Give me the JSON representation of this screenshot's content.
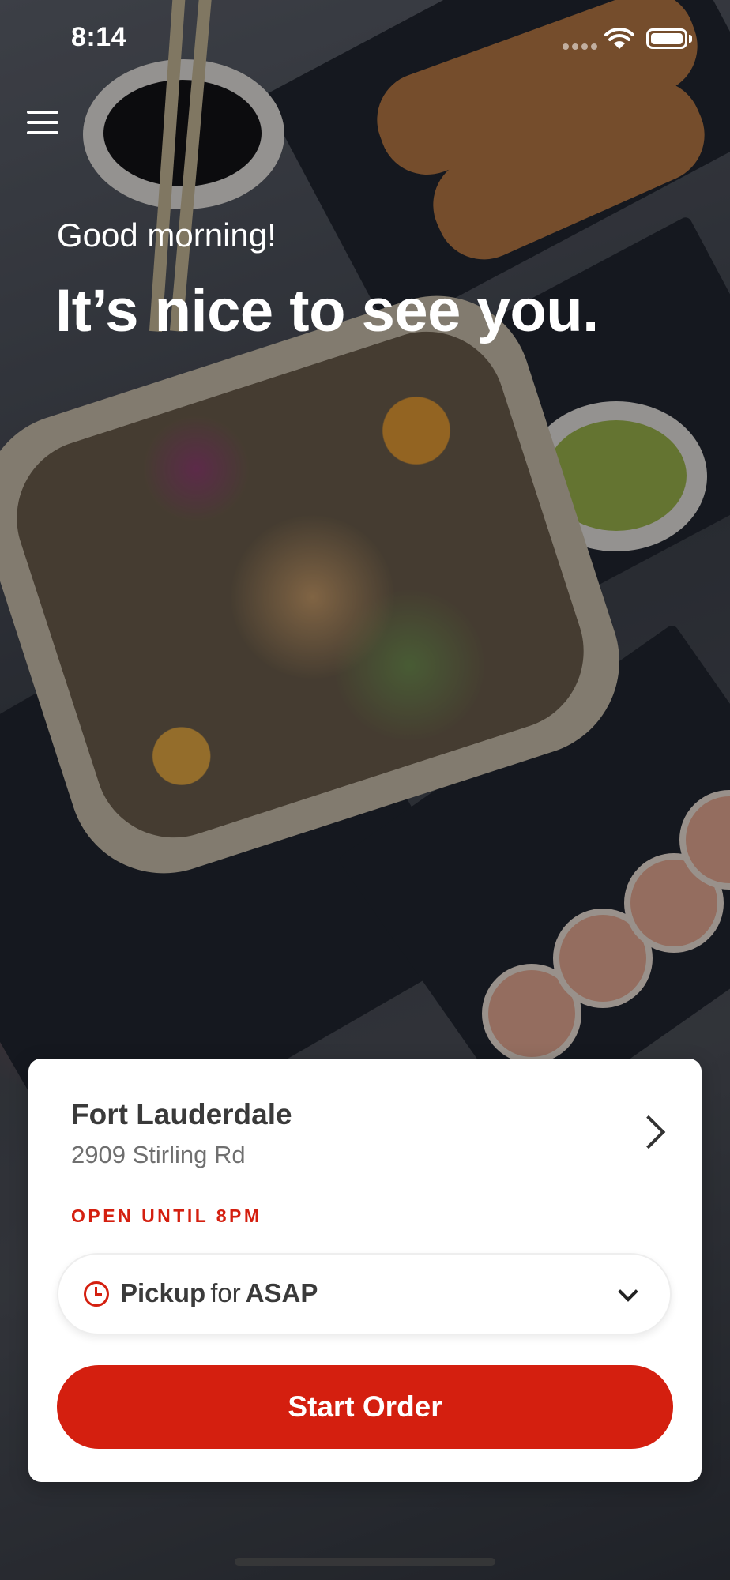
{
  "status_bar": {
    "time": "8:14",
    "icons": [
      "signal-icon",
      "wifi-icon",
      "battery-icon"
    ]
  },
  "header": {
    "menu_icon": "hamburger-menu-icon",
    "greeting": "Good morning!",
    "headline": "It’s nice to see you."
  },
  "location_card": {
    "name": "Fort Lauderdale",
    "address": "2909 Stirling Rd",
    "hours": "OPEN UNTIL 8PM",
    "order_mode": {
      "mode": "Pickup",
      "connector": "for",
      "time": "ASAP",
      "icon": "clock-icon"
    },
    "cta_label": "Start Order"
  },
  "colors": {
    "accent": "#d41f0f",
    "card_background": "#ffffff",
    "text_primary": "#3a3a3a",
    "text_secondary": "#6f6f6f"
  }
}
